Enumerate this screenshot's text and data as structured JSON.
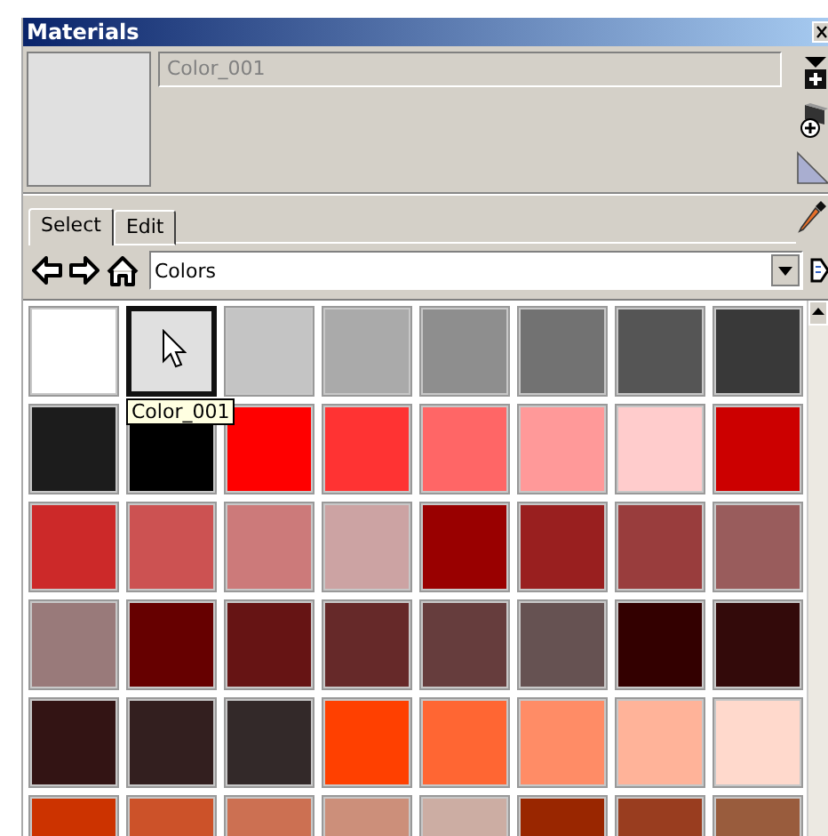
{
  "window": {
    "title": "Materials"
  },
  "material_name": {
    "value": "Color_001"
  },
  "tabs": [
    {
      "label": "Select",
      "selected": true
    },
    {
      "label": "Edit",
      "selected": false
    }
  ],
  "library": {
    "value": "Colors"
  },
  "tooltip": {
    "text": "Color_001"
  },
  "swatches": [
    {
      "color": "#ffffff",
      "selected": false
    },
    {
      "color": "#e0e0e0",
      "selected": true
    },
    {
      "color": "#c4c4c4",
      "selected": false
    },
    {
      "color": "#aaaaaa",
      "selected": false
    },
    {
      "color": "#8e8e8e",
      "selected": false
    },
    {
      "color": "#727272",
      "selected": false
    },
    {
      "color": "#555555",
      "selected": false
    },
    {
      "color": "#393939",
      "selected": false
    },
    {
      "color": "#1c1c1c",
      "selected": false
    },
    {
      "color": "#000000",
      "selected": false
    },
    {
      "color": "#ff0000",
      "selected": false
    },
    {
      "color": "#ff3333",
      "selected": false
    },
    {
      "color": "#ff6666",
      "selected": false
    },
    {
      "color": "#ff9999",
      "selected": false
    },
    {
      "color": "#ffcccc",
      "selected": false
    },
    {
      "color": "#cc0000",
      "selected": false
    },
    {
      "color": "#cc2929",
      "selected": false
    },
    {
      "color": "#cc5252",
      "selected": false
    },
    {
      "color": "#cc7a7a",
      "selected": false
    },
    {
      "color": "#cca3a3",
      "selected": false
    },
    {
      "color": "#990000",
      "selected": false
    },
    {
      "color": "#991f1f",
      "selected": false
    },
    {
      "color": "#993d3d",
      "selected": false
    },
    {
      "color": "#995c5c",
      "selected": false
    },
    {
      "color": "#997a7a",
      "selected": false
    },
    {
      "color": "#660000",
      "selected": false
    },
    {
      "color": "#661414",
      "selected": false
    },
    {
      "color": "#662929",
      "selected": false
    },
    {
      "color": "#663d3d",
      "selected": false
    },
    {
      "color": "#665252",
      "selected": false
    },
    {
      "color": "#330000",
      "selected": false
    },
    {
      "color": "#330a0a",
      "selected": false
    },
    {
      "color": "#331414",
      "selected": false
    },
    {
      "color": "#331f1f",
      "selected": false
    },
    {
      "color": "#332929",
      "selected": false
    },
    {
      "color": "#ff4000",
      "selected": false
    },
    {
      "color": "#ff6633",
      "selected": false
    },
    {
      "color": "#ff8c66",
      "selected": false
    },
    {
      "color": "#ffb399",
      "selected": false
    },
    {
      "color": "#ffd9cc",
      "selected": false
    },
    {
      "color": "#cc3300",
      "selected": false
    },
    {
      "color": "#cc5229",
      "selected": false
    },
    {
      "color": "#cc7052",
      "selected": false
    },
    {
      "color": "#cc8f7a",
      "selected": false
    },
    {
      "color": "#ccada3",
      "selected": false
    },
    {
      "color": "#992600",
      "selected": false
    },
    {
      "color": "#993d1f",
      "selected": false
    },
    {
      "color": "#995c3d",
      "selected": false
    }
  ]
}
